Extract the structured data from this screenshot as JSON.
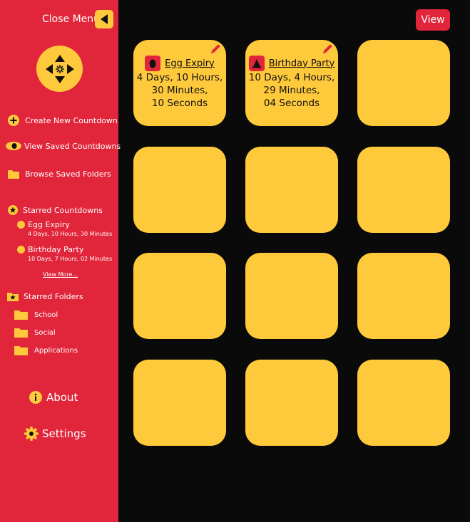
{
  "sidebar": {
    "close_menu_label": "Close Menu",
    "nav": {
      "create_new": "Create New Countdown",
      "view_saved": "View Saved Countdowns",
      "browse_folders": "Browse Saved Folders"
    },
    "starred_countdowns": {
      "heading": "Starred Countdowns",
      "items": [
        {
          "name": "Egg Expiry",
          "time": "4 Days, 10 Hours, 30 Minutes"
        },
        {
          "name": "Birthday Party",
          "time": "10 Days, 7 Hours, 02 Minutes"
        }
      ],
      "view_more": "View More..."
    },
    "starred_folders": {
      "heading": "Starred Folders",
      "items": [
        "School",
        "Social",
        "Applications"
      ]
    },
    "about": "About",
    "settings": "Settings"
  },
  "header": {
    "view_button": "View"
  },
  "tiles": [
    {
      "title": "Egg Expiry",
      "icon": "egg-icon",
      "lines": [
        "4 Days, 10 Hours,",
        "30 Minutes,",
        "10 Seconds"
      ]
    },
    {
      "title": "Birthday Party",
      "icon": "party-hat-icon",
      "lines": [
        "10 Days, 4 Hours,",
        "29 Minutes,",
        "04 Seconds"
      ]
    }
  ],
  "colors": {
    "accent_red": "#e1253a",
    "tile_yellow": "#ffc93c",
    "background": "#0a0a0a"
  }
}
